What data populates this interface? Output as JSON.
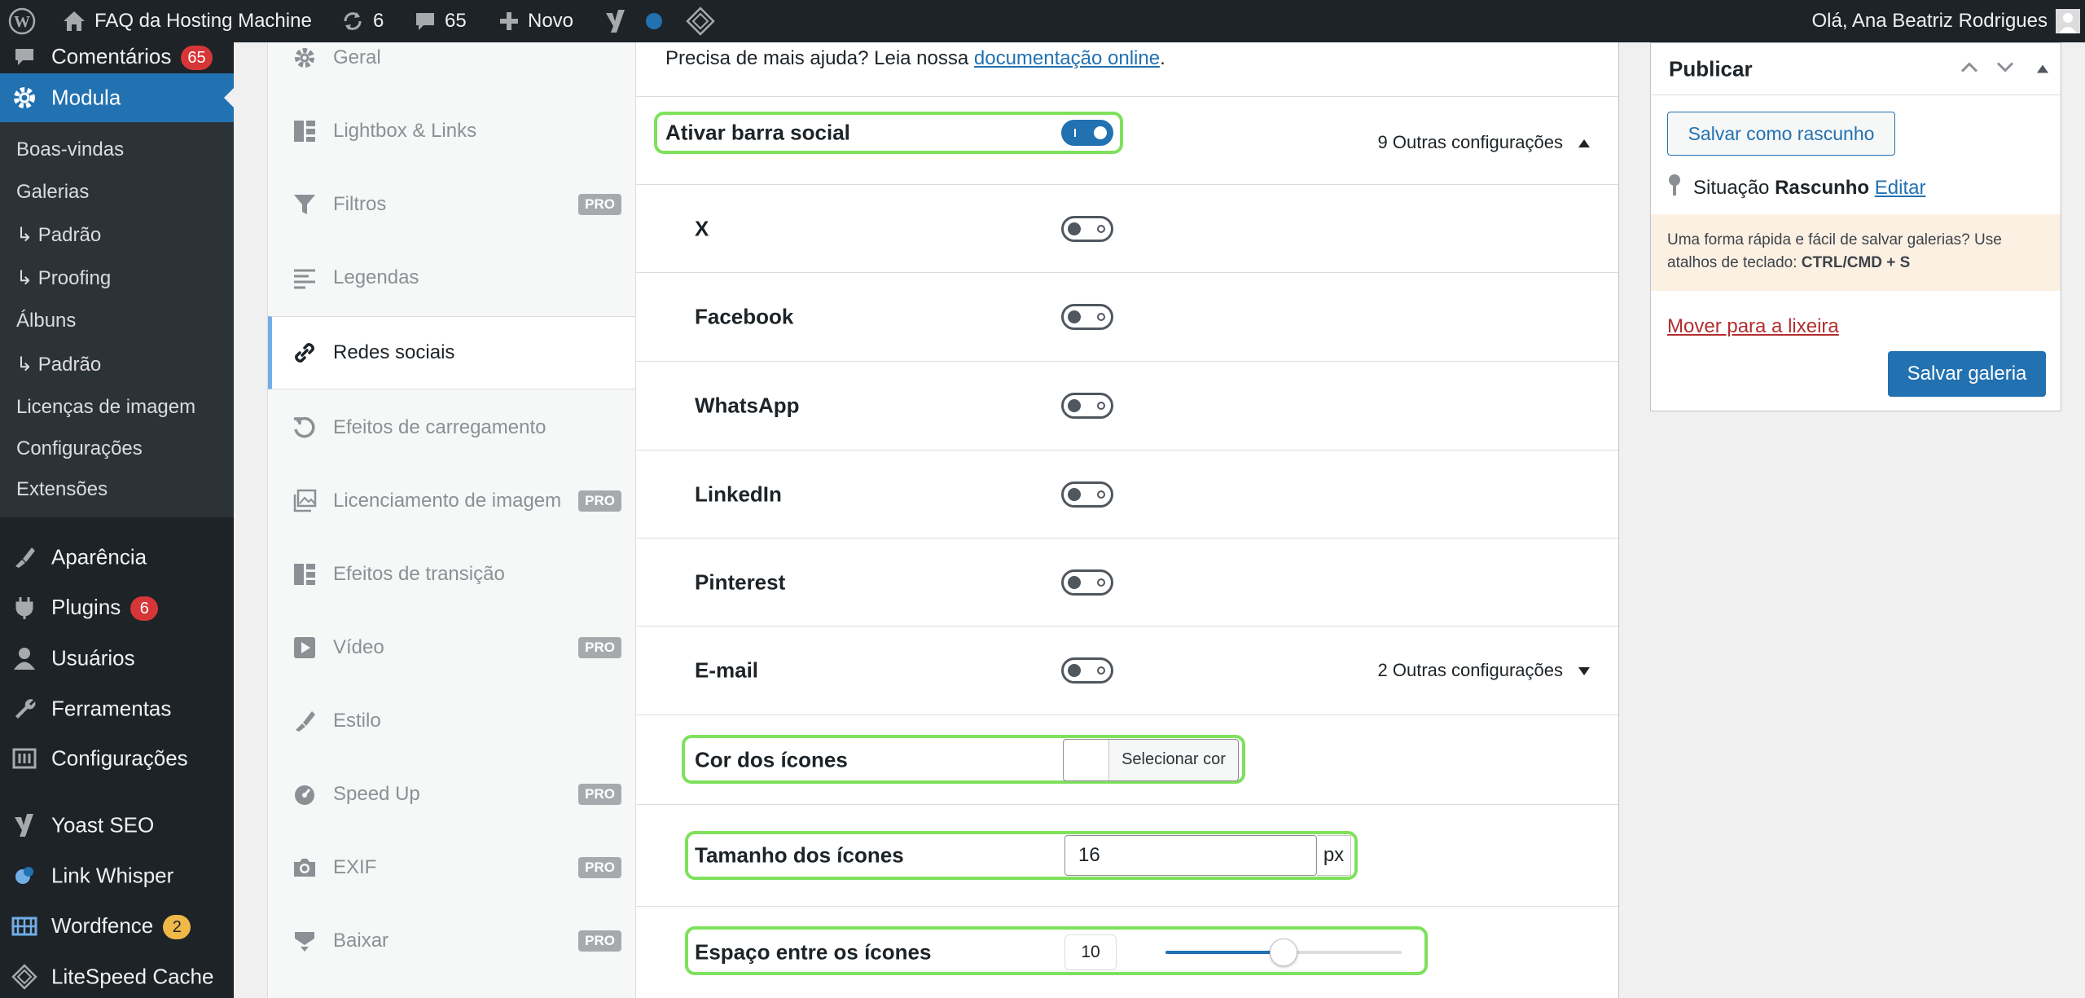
{
  "admin_bar": {
    "site_name": "FAQ da Hosting Machine",
    "updates_count": "6",
    "comments_count": "65",
    "new_label": "Novo",
    "greeting": "Olá, Ana Beatriz Rodrigues"
  },
  "admin_menu": {
    "comments": {
      "label": "Comentários",
      "badge": "65"
    },
    "modula": {
      "label": "Modula"
    },
    "submenu": [
      "Boas-vindas",
      "Galerias",
      "↳ Padrão",
      "↳ Proofing",
      "Álbuns",
      "↳ Padrão",
      "Licenças de imagem",
      "Configurações",
      "Extensões"
    ],
    "items": [
      {
        "label": "Aparência",
        "badge": "",
        "icon": "brush-icon"
      },
      {
        "label": "Plugins",
        "badge": "6",
        "icon": "plugin-icon"
      },
      {
        "label": "Usuários",
        "badge": "",
        "icon": "users-icon"
      },
      {
        "label": "Ferramentas",
        "badge": "",
        "icon": "wrench-icon"
      },
      {
        "label": "Configurações",
        "badge": "",
        "icon": "settings-icon"
      },
      {
        "label": "Yoast SEO",
        "badge": "",
        "icon": "yoast-icon"
      },
      {
        "label": "Link Whisper",
        "badge": "",
        "icon": "link-whisper-icon"
      },
      {
        "label": "Wordfence",
        "badge": "2",
        "icon": "wordfence-icon"
      },
      {
        "label": "LiteSpeed Cache",
        "badge": "",
        "icon": "litespeed-icon"
      }
    ]
  },
  "settings_tabs": [
    {
      "label": "Geral",
      "pro": "",
      "icon": "gear-icon"
    },
    {
      "label": "Lightbox & Links",
      "pro": "",
      "icon": "grid-icon"
    },
    {
      "label": "Filtros",
      "pro": "PRO",
      "icon": "filter-icon"
    },
    {
      "label": "Legendas",
      "pro": "",
      "icon": "lines-icon"
    },
    {
      "label": "Redes sociais",
      "pro": "",
      "icon": "link-icon",
      "active": true
    },
    {
      "label": "Efeitos de carregamento",
      "pro": "",
      "icon": "reload-icon"
    },
    {
      "label": "Licenciamento de imagem",
      "pro": "PRO",
      "icon": "images-icon"
    },
    {
      "label": "Efeitos de transição",
      "pro": "",
      "icon": "grid-icon"
    },
    {
      "label": "Vídeo",
      "pro": "PRO",
      "icon": "video-icon"
    },
    {
      "label": "Estilo",
      "pro": "",
      "icon": "brush-icon"
    },
    {
      "label": "Speed Up",
      "pro": "PRO",
      "icon": "speedometer-icon"
    },
    {
      "label": "EXIF",
      "pro": "PRO",
      "icon": "camera-icon"
    },
    {
      "label": "Baixar",
      "pro": "PRO",
      "icon": "download-icon"
    }
  ],
  "content": {
    "help_text": "Precisa de mais ajuda? Leia nossa ",
    "help_link": "documentação online",
    "help_end": ".",
    "social_bar": {
      "label": "Ativar barra social",
      "enabled": true,
      "more": "9 Outras configurações"
    },
    "networks": [
      {
        "label": "X",
        "enabled": false
      },
      {
        "label": "Facebook",
        "enabled": false
      },
      {
        "label": "WhatsApp",
        "enabled": false
      },
      {
        "label": "LinkedIn",
        "enabled": false
      },
      {
        "label": "Pinterest",
        "enabled": false
      },
      {
        "label": "E-mail",
        "enabled": false
      }
    ],
    "email_more": "2 Outras configurações",
    "icon_color": {
      "label": "Cor dos ícones",
      "button": "Selecionar cor"
    },
    "icon_size": {
      "label": "Tamanho dos ícones",
      "value": "16",
      "unit": "px"
    },
    "icon_spacing": {
      "label": "Espaço entre os ícones",
      "value": "10",
      "min": 0,
      "max": 20
    }
  },
  "publish": {
    "title": "Publicar",
    "save_draft": "Salvar como rascunho",
    "status_label": "Situação",
    "status_value": "Rascunho",
    "edit": "Editar",
    "tip": "Uma forma rápida e fácil de salvar galerias? Use atalhos de teclado: ",
    "tip_shortcut": "CTRL/CMD + S",
    "trash": "Mover para a lixeira",
    "save": "Salvar galeria"
  },
  "colors": {
    "accent": "#2271b1",
    "highlight": "#7ee15c",
    "menu_bg": "#1d2327"
  }
}
